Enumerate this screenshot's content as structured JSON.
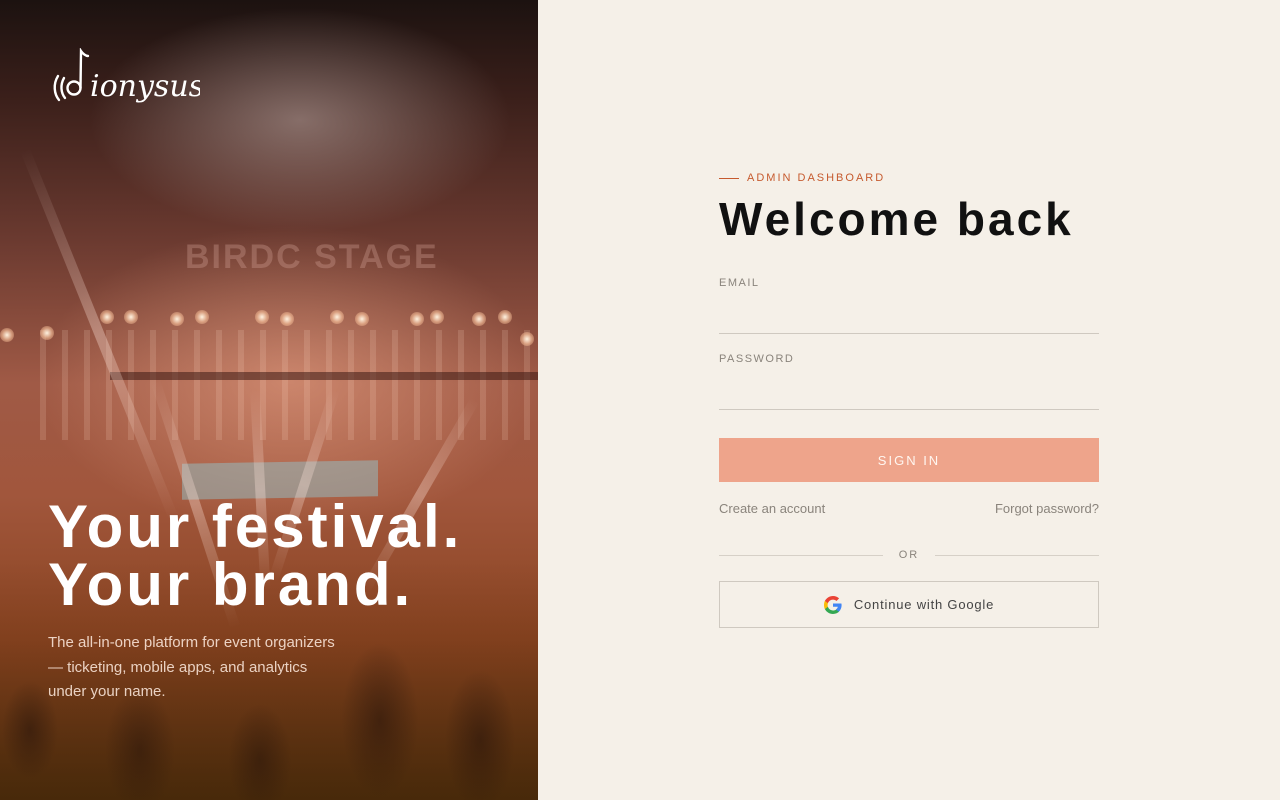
{
  "brand": {
    "name": "dionysus"
  },
  "hero": {
    "stage_text": "BIRDC STAGE",
    "title_line1": "Your festival.",
    "title_line2": "Your brand.",
    "subtitle": "The all-in-one platform for event organizers — ticketing, mobile apps, and analytics under your name."
  },
  "form": {
    "eyebrow": "ADMIN DASHBOARD",
    "heading": "Welcome back",
    "email_label": "EMAIL",
    "email_value": "",
    "password_label": "PASSWORD",
    "password_value": "",
    "signin_label": "SIGN IN",
    "create_account": "Create an account",
    "forgot_password": "Forgot password?",
    "or_text": "OR",
    "google_label": "Continue with Google"
  },
  "colors": {
    "accent": "#c65a2e",
    "button_bg": "#eea48b",
    "page_bg": "#f5f0e8"
  },
  "icons": {
    "google": "google-g-icon",
    "logo": "music-note-logo-icon"
  }
}
